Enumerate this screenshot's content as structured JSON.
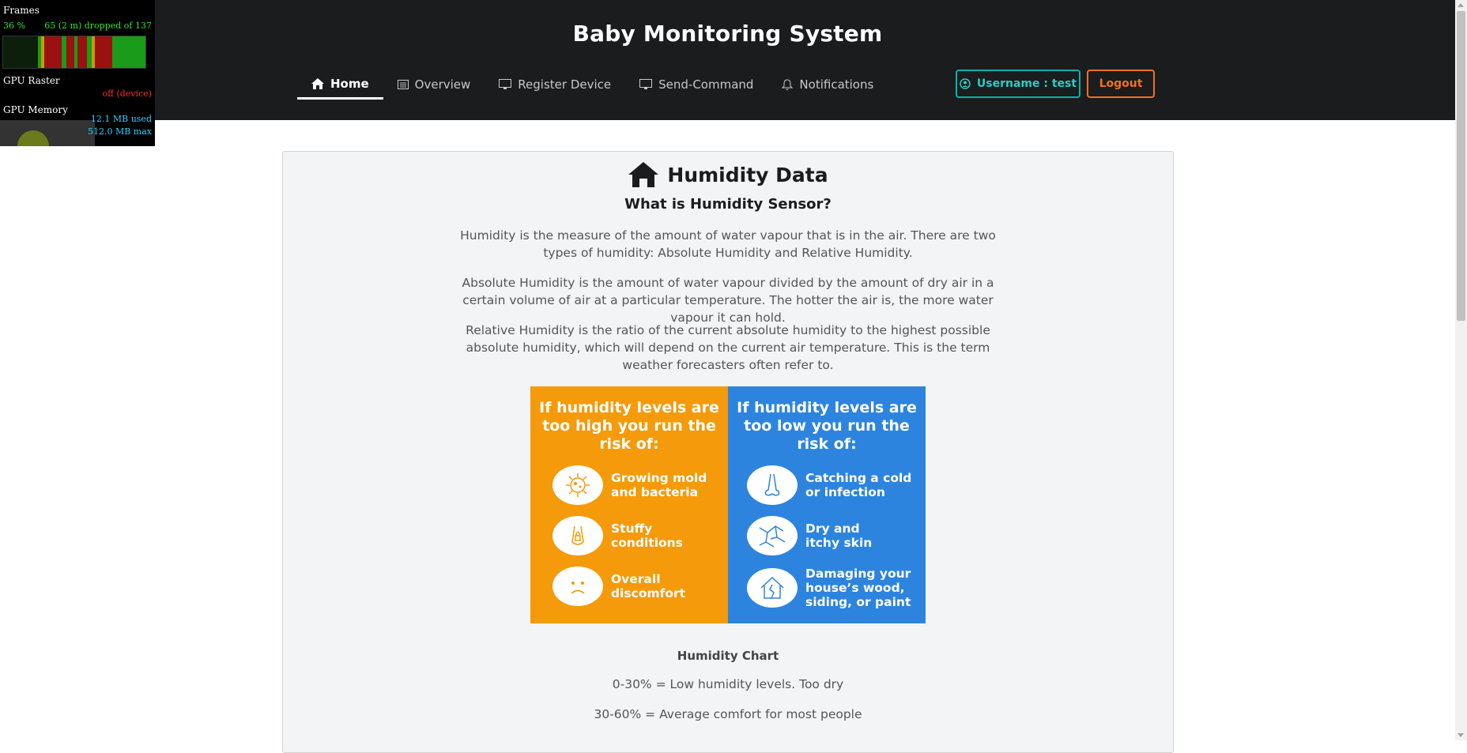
{
  "header": {
    "title": "Baby Monitoring System",
    "nav": [
      {
        "label": "Home",
        "icon": "home-icon",
        "active": true
      },
      {
        "label": "Overview",
        "icon": "list-icon"
      },
      {
        "label": "Register Device",
        "icon": "desktop-icon"
      },
      {
        "label": "Send-Command",
        "icon": "desktop-icon"
      },
      {
        "label": "Notifications",
        "icon": "bell-icon"
      }
    ],
    "user_button": "Username : test",
    "logout_button": "Logout"
  },
  "fps_overlay": {
    "frames_label": "Frames",
    "percent": "36 %",
    "dropped": "65 (2 m) dropped of 137",
    "raster_label": "GPU Raster",
    "raster_status": "off (device)",
    "memory_label": "GPU Memory",
    "memory_used": "12.1 MB used",
    "memory_max": "512.0 MB max"
  },
  "content": {
    "title": "Humidity Data",
    "subtitle": "What is Humidity Sensor?",
    "paragraphs": [
      "Humidity is the measure of the amount of water vapour that is in the air. There are two types of humidity: Absolute Humidity and Relative Humidity.",
      "Absolute Humidity is the amount of water vapour divided by the amount of dry air in a certain volume of air at a particular temperature. The hotter the air is, the more water vapour it can hold.",
      "Relative Humidity is the ratio of the current absolute humidity to the highest possible absolute humidity, which will depend on the current air temperature. This is the term weather forecasters often refer to."
    ],
    "infographic": {
      "high": {
        "title": "If humidity levels are too high you run the risk of:",
        "items": [
          "Growing mold and bacteria",
          "Stuffy conditions",
          "Overall discomfort"
        ]
      },
      "low": {
        "title": "If humidity levels are too low you run the risk of:",
        "items": [
          "Catching a cold or infection",
          "Dry and itchy skin",
          "Damaging your house’s wood, siding, or paint"
        ]
      }
    },
    "chart_title": "Humidity Chart",
    "chart_lines": [
      "0-30% = Low humidity levels. Too dry",
      "30-60% = Average comfort for most people"
    ]
  },
  "colors": {
    "header_bg": "#1b1c1d",
    "teal": "#00b5ad",
    "orange_button": "#f2711c",
    "panel_orange": "#f59a0a",
    "panel_blue": "#2d84de"
  }
}
